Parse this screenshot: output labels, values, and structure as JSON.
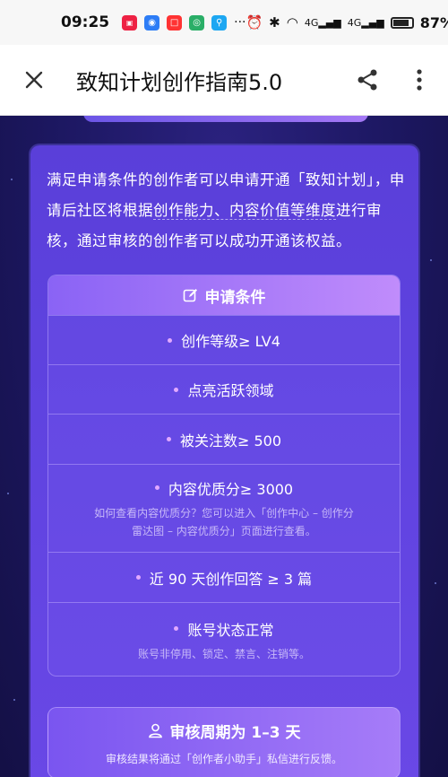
{
  "status_bar": {
    "time": "09:25",
    "battery": "87%",
    "network_a": "4G",
    "network_b": "4G",
    "more_dots": "···"
  },
  "title_bar": {
    "title": "致知计划创作指南5.0"
  },
  "intro": {
    "part1": "满足申请条件的创作者可以申请开通「致知计划」，申请后社区将根据",
    "hl1": "创作能力、内容价值等维度",
    "part2": "进行审核，通过审核的创作者可以成功开通该权益。"
  },
  "requirements": {
    "header": "申请条件",
    "items": [
      {
        "main": "创作等级≥ LV4",
        "sub": ""
      },
      {
        "main": "点亮活跃领域",
        "sub": ""
      },
      {
        "main": "被关注数≥ 500",
        "sub": ""
      },
      {
        "main": "内容优质分≥ 3000",
        "sub": "如何查看内容优质分？您可以进入「创作中心 – 创作分雷达图 – 内容优质分」页面进行查看。"
      },
      {
        "main": "近 90 天创作回答 ≥ 3 篇",
        "sub": ""
      },
      {
        "main": "账号状态正常",
        "sub": "账号非停用、锁定、禁言、注销等。"
      }
    ]
  },
  "review": {
    "title": "审核周期为 1–3 天",
    "subtitle": "审核结果将通过「创作者小助手」私信进行反馈。"
  },
  "colors": {
    "panel": "#5f43e0",
    "header_gradient_start": "#8a63f5",
    "header_gradient_end": "#c08cfb",
    "bullet": "#e2a9ff"
  }
}
